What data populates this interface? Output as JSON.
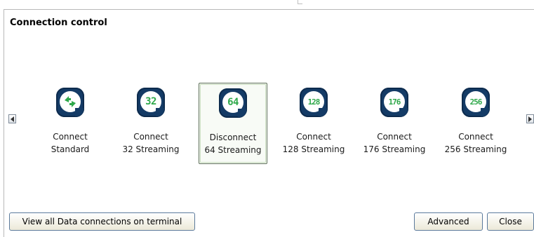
{
  "panel": {
    "title": "Connection control"
  },
  "connections": [
    {
      "line1": "Connect",
      "line2": "Standard",
      "badge": "",
      "icon": "arrows-icon",
      "selected": false
    },
    {
      "line1": "Connect",
      "line2": "32 Streaming",
      "badge": "32",
      "icon": "badge-32-icon",
      "selected": false
    },
    {
      "line1": "Disconnect",
      "line2": "64 Streaming",
      "badge": "64",
      "icon": "badge-64-icon",
      "selected": true
    },
    {
      "line1": "Connect",
      "line2": "128 Streaming",
      "badge": "128",
      "icon": "badge-128-icon",
      "selected": false
    },
    {
      "line1": "Connect",
      "line2": "176 Streaming",
      "badge": "176",
      "icon": "badge-176-icon",
      "selected": false
    },
    {
      "line1": "Connect",
      "line2": "256 Streaming",
      "badge": "256",
      "icon": "badge-256-icon",
      "selected": false
    }
  ],
  "buttons": {
    "view_all": "View all Data connections on terminal",
    "advanced": "Advanced",
    "close": "Close"
  },
  "colors": {
    "badge_bg": "#143b66",
    "badge_text": "#2ea84a",
    "selected_border": "#5d6f58"
  }
}
